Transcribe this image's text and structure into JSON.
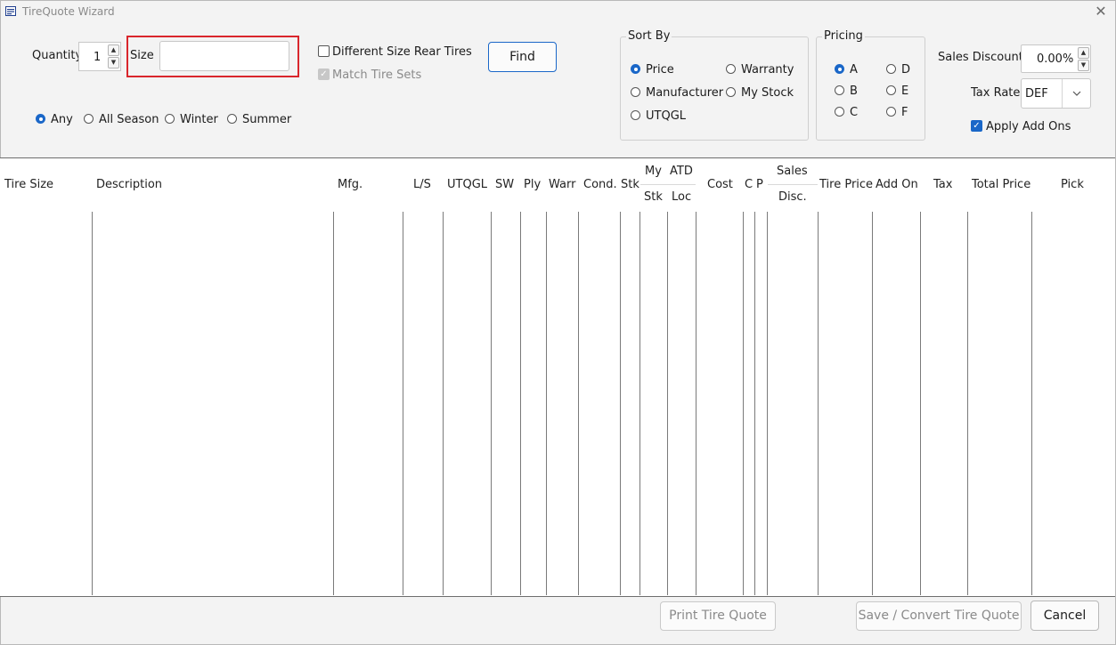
{
  "window": {
    "title": "TireQuote Wizard",
    "close_symbol": "✕"
  },
  "quantity": {
    "label": "Quantity",
    "value": "1",
    "up": "▲",
    "down": "▼"
  },
  "size": {
    "label": "Size",
    "value": ""
  },
  "options": {
    "different_size_rear": "Different Size Rear Tires",
    "match_tire_sets": "Match Tire Sets"
  },
  "find_label": "Find",
  "season": {
    "any": "Any",
    "all_season": "All Season",
    "winter": "Winter",
    "summer": "Summer",
    "selected": "Any"
  },
  "sort_by": {
    "title": "Sort By",
    "price": "Price",
    "warranty": "Warranty",
    "manufacturer": "Manufacturer",
    "my_stock": "My Stock",
    "utqgl": "UTQGL",
    "selected": "Price"
  },
  "pricing": {
    "title": "Pricing",
    "a": "A",
    "b": "B",
    "c": "C",
    "d": "D",
    "e": "E",
    "f": "F",
    "selected": "A"
  },
  "sales_discount": {
    "label": "Sales Discount",
    "value": "0.00%"
  },
  "tax_rate": {
    "label": "Tax Rate",
    "value": "DEF"
  },
  "apply_add_ons": {
    "label": "Apply Add Ons",
    "checked": true
  },
  "grid": {
    "headers": {
      "tire_size": "Tire Size",
      "description": "Description",
      "mfg": "Mfg.",
      "ls": "L/S",
      "utqgl": "UTQGL",
      "sw": "SW",
      "ply": "Ply",
      "warr": "Warr",
      "cond": "Cond.",
      "stk": "Stk",
      "my_top": "My",
      "my_bottom": "Stk",
      "atd_top": "ATD",
      "atd_bottom": "Loc",
      "cost": "Cost",
      "c": "C",
      "p": "P",
      "sales_top": "Sales",
      "sales_bottom": "Disc.",
      "tire_price": "Tire Price",
      "add_on": "Add On",
      "tax": "Tax",
      "total_price": "Total Price",
      "pick": "Pick"
    },
    "rows": []
  },
  "footer": {
    "print": "Print Tire Quote",
    "save_convert": "Save / Convert Tire Quote",
    "cancel": "Cancel"
  },
  "colors": {
    "accent": "#1a67c8",
    "highlight": "#d9262c"
  }
}
